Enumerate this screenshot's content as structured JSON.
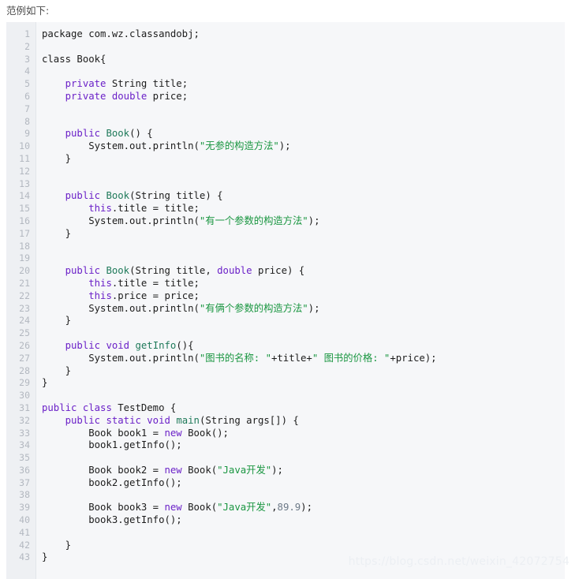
{
  "intro": {
    "text": "范例如下:"
  },
  "code_block": {
    "language": "java",
    "background_color": "#f6f7f9",
    "gutter_color": "#eef0f3",
    "line_number_color": "#b3b8c0",
    "keyword_color": "#6b21c8",
    "type_color": "#1f7a5a",
    "string_color": "#1a9641",
    "number_color": "#6d7a88",
    "plain_color": "#1c1c1c",
    "line_numbers": [
      1,
      2,
      3,
      4,
      5,
      6,
      7,
      8,
      9,
      10,
      11,
      12,
      13,
      14,
      15,
      16,
      17,
      18,
      19,
      20,
      21,
      22,
      23,
      24,
      25,
      26,
      27,
      28,
      29,
      30,
      31,
      32,
      33,
      34,
      35,
      36,
      37,
      38,
      39,
      40,
      41,
      42,
      43
    ],
    "lines": [
      {
        "n": 1,
        "tokens": [
          {
            "c": "p",
            "v": "package com.wz.classandobj;"
          }
        ]
      },
      {
        "n": 2,
        "tokens": []
      },
      {
        "n": 3,
        "tokens": [
          {
            "c": "p",
            "v": "class Book{"
          }
        ]
      },
      {
        "n": 4,
        "tokens": []
      },
      {
        "n": 5,
        "tokens": [
          {
            "c": "p",
            "v": "    "
          },
          {
            "c": "k",
            "v": "private"
          },
          {
            "c": "p",
            "v": " String title;"
          }
        ]
      },
      {
        "n": 6,
        "tokens": [
          {
            "c": "p",
            "v": "    "
          },
          {
            "c": "k",
            "v": "private"
          },
          {
            "c": "p",
            "v": " "
          },
          {
            "c": "k",
            "v": "double"
          },
          {
            "c": "p",
            "v": " price;"
          }
        ]
      },
      {
        "n": 7,
        "tokens": []
      },
      {
        "n": 8,
        "tokens": []
      },
      {
        "n": 9,
        "tokens": [
          {
            "c": "p",
            "v": "    "
          },
          {
            "c": "k",
            "v": "public"
          },
          {
            "c": "p",
            "v": " "
          },
          {
            "c": "t",
            "v": "Book"
          },
          {
            "c": "p",
            "v": "() {"
          }
        ]
      },
      {
        "n": 10,
        "tokens": [
          {
            "c": "p",
            "v": "        System.out.println("
          },
          {
            "c": "s",
            "v": "\"无参的构造方法\""
          },
          {
            "c": "p",
            "v": ");"
          }
        ]
      },
      {
        "n": 11,
        "tokens": [
          {
            "c": "p",
            "v": "    }"
          }
        ]
      },
      {
        "n": 12,
        "tokens": []
      },
      {
        "n": 13,
        "tokens": []
      },
      {
        "n": 14,
        "tokens": [
          {
            "c": "p",
            "v": "    "
          },
          {
            "c": "k",
            "v": "public"
          },
          {
            "c": "p",
            "v": " "
          },
          {
            "c": "t",
            "v": "Book"
          },
          {
            "c": "p",
            "v": "(String title) {"
          }
        ]
      },
      {
        "n": 15,
        "tokens": [
          {
            "c": "p",
            "v": "        "
          },
          {
            "c": "k",
            "v": "this"
          },
          {
            "c": "p",
            "v": ".title = title;"
          }
        ]
      },
      {
        "n": 16,
        "tokens": [
          {
            "c": "p",
            "v": "        System.out.println("
          },
          {
            "c": "s",
            "v": "\"有一个参数的构造方法\""
          },
          {
            "c": "p",
            "v": ");"
          }
        ]
      },
      {
        "n": 17,
        "tokens": [
          {
            "c": "p",
            "v": "    }"
          }
        ]
      },
      {
        "n": 18,
        "tokens": []
      },
      {
        "n": 19,
        "tokens": []
      },
      {
        "n": 20,
        "tokens": [
          {
            "c": "p",
            "v": "    "
          },
          {
            "c": "k",
            "v": "public"
          },
          {
            "c": "p",
            "v": " "
          },
          {
            "c": "t",
            "v": "Book"
          },
          {
            "c": "p",
            "v": "(String title, "
          },
          {
            "c": "k",
            "v": "double"
          },
          {
            "c": "p",
            "v": " price) {"
          }
        ]
      },
      {
        "n": 21,
        "tokens": [
          {
            "c": "p",
            "v": "        "
          },
          {
            "c": "k",
            "v": "this"
          },
          {
            "c": "p",
            "v": ".title = title;"
          }
        ]
      },
      {
        "n": 22,
        "tokens": [
          {
            "c": "p",
            "v": "        "
          },
          {
            "c": "k",
            "v": "this"
          },
          {
            "c": "p",
            "v": ".price = price;"
          }
        ]
      },
      {
        "n": 23,
        "tokens": [
          {
            "c": "p",
            "v": "        System.out.println("
          },
          {
            "c": "s",
            "v": "\"有俩个参数的构造方法\""
          },
          {
            "c": "p",
            "v": ");"
          }
        ]
      },
      {
        "n": 24,
        "tokens": [
          {
            "c": "p",
            "v": "    }"
          }
        ]
      },
      {
        "n": 25,
        "tokens": []
      },
      {
        "n": 26,
        "tokens": [
          {
            "c": "p",
            "v": "    "
          },
          {
            "c": "k",
            "v": "public"
          },
          {
            "c": "p",
            "v": " "
          },
          {
            "c": "k",
            "v": "void"
          },
          {
            "c": "p",
            "v": " "
          },
          {
            "c": "t",
            "v": "getInfo"
          },
          {
            "c": "p",
            "v": "(){"
          }
        ]
      },
      {
        "n": 27,
        "tokens": [
          {
            "c": "p",
            "v": "        System.out.println("
          },
          {
            "c": "s",
            "v": "\"图书的名称: \""
          },
          {
            "c": "p",
            "v": "+title+"
          },
          {
            "c": "s",
            "v": "\" 图书的价格: \""
          },
          {
            "c": "p",
            "v": "+price);"
          }
        ]
      },
      {
        "n": 28,
        "tokens": [
          {
            "c": "p",
            "v": "    }"
          }
        ]
      },
      {
        "n": 29,
        "tokens": [
          {
            "c": "p",
            "v": "}"
          }
        ]
      },
      {
        "n": 30,
        "tokens": []
      },
      {
        "n": 31,
        "tokens": [
          {
            "c": "k",
            "v": "public"
          },
          {
            "c": "p",
            "v": " "
          },
          {
            "c": "k",
            "v": "class"
          },
          {
            "c": "p",
            "v": " TestDemo {"
          }
        ]
      },
      {
        "n": 32,
        "tokens": [
          {
            "c": "p",
            "v": "    "
          },
          {
            "c": "k",
            "v": "public"
          },
          {
            "c": "p",
            "v": " "
          },
          {
            "c": "k",
            "v": "static"
          },
          {
            "c": "p",
            "v": " "
          },
          {
            "c": "k",
            "v": "void"
          },
          {
            "c": "p",
            "v": " "
          },
          {
            "c": "t",
            "v": "main"
          },
          {
            "c": "p",
            "v": "(String args[]) {"
          }
        ]
      },
      {
        "n": 33,
        "tokens": [
          {
            "c": "p",
            "v": "        Book book1 = "
          },
          {
            "c": "k",
            "v": "new"
          },
          {
            "c": "p",
            "v": " Book();"
          }
        ]
      },
      {
        "n": 34,
        "tokens": [
          {
            "c": "p",
            "v": "        book1.getInfo();"
          }
        ]
      },
      {
        "n": 35,
        "tokens": []
      },
      {
        "n": 36,
        "tokens": [
          {
            "c": "p",
            "v": "        Book book2 = "
          },
          {
            "c": "k",
            "v": "new"
          },
          {
            "c": "p",
            "v": " Book("
          },
          {
            "c": "s",
            "v": "\"Java开发\""
          },
          {
            "c": "p",
            "v": ");"
          }
        ]
      },
      {
        "n": 37,
        "tokens": [
          {
            "c": "p",
            "v": "        book2.getInfo();"
          }
        ]
      },
      {
        "n": 38,
        "tokens": []
      },
      {
        "n": 39,
        "tokens": [
          {
            "c": "p",
            "v": "        Book book3 = "
          },
          {
            "c": "k",
            "v": "new"
          },
          {
            "c": "p",
            "v": " Book("
          },
          {
            "c": "s",
            "v": "\"Java开发\""
          },
          {
            "c": "p",
            "v": ","
          },
          {
            "c": "n",
            "v": "89.9"
          },
          {
            "c": "p",
            "v": ");"
          }
        ]
      },
      {
        "n": 40,
        "tokens": [
          {
            "c": "p",
            "v": "        book3.getInfo();"
          }
        ]
      },
      {
        "n": 41,
        "tokens": []
      },
      {
        "n": 42,
        "tokens": [
          {
            "c": "p",
            "v": "    }"
          }
        ]
      },
      {
        "n": 43,
        "tokens": [
          {
            "c": "p",
            "v": "}"
          }
        ]
      }
    ]
  },
  "watermark": {
    "text": "https://blog.csdn.net/weixin_42072754"
  }
}
